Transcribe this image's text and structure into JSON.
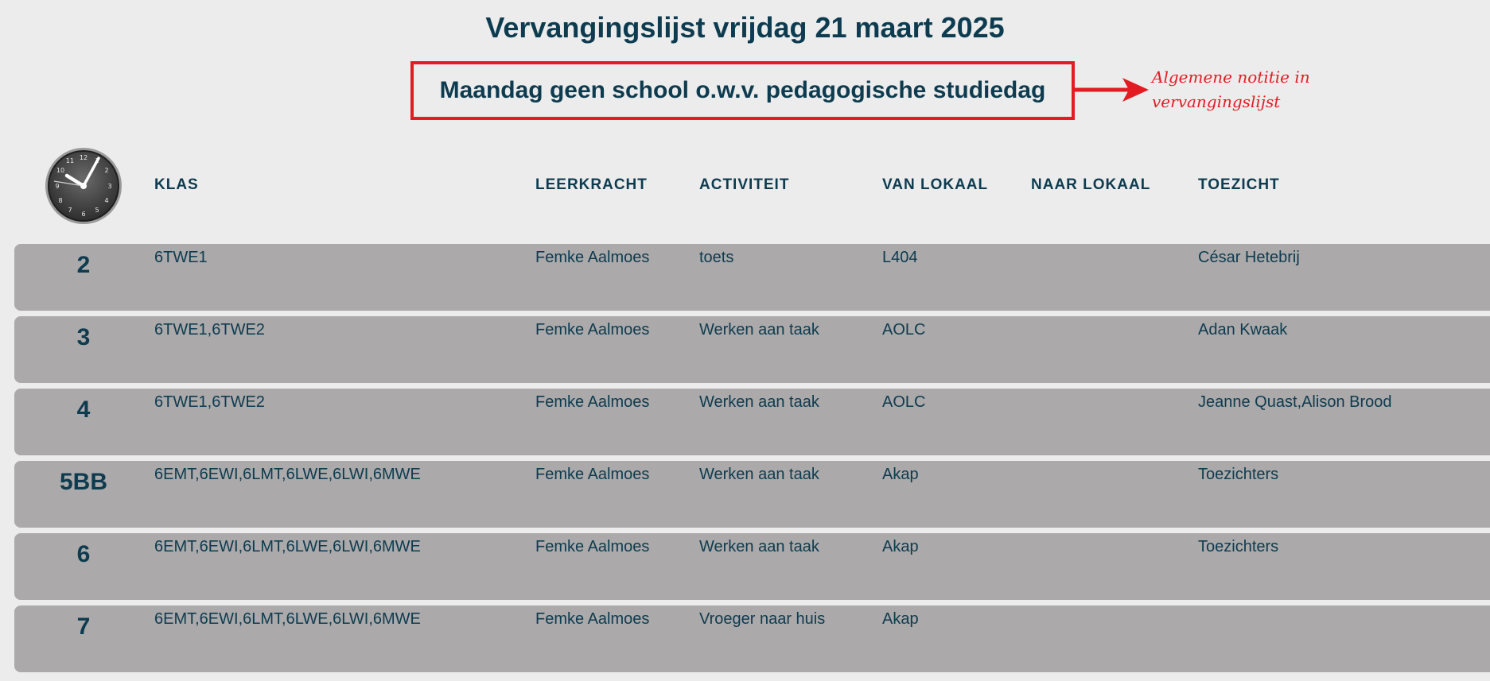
{
  "page": {
    "title": "Vervangingslijst vrijdag 21 maart 2025"
  },
  "notice": {
    "text": "Maandag geen school o.w.v. pedagogische studiedag"
  },
  "annotation": {
    "text": "Algemene notitie in vervangingslijst"
  },
  "clock_icon": "clock-icon",
  "colors": {
    "text": "#0d3b4f",
    "accent": "#e31b23",
    "row_bg": "#aba9aa",
    "page_bg": "#ececec"
  },
  "table": {
    "headers": {
      "klas": "KLAS",
      "leerkracht": "LEERKRACHT",
      "activiteit": "ACTIVITEIT",
      "van_lokaal": "VAN LOKAAL",
      "naar_lokaal": "NAAR LOKAAL",
      "toezicht": "TOEZICHT"
    },
    "rows": [
      {
        "hour": "2",
        "klas": "6TWE1",
        "leerkracht": "Femke Aalmoes",
        "activiteit": "toets",
        "van_lokaal": "L404",
        "naar_lokaal": "",
        "toezicht": "César Hetebrij"
      },
      {
        "hour": "3",
        "klas": "6TWE1,6TWE2",
        "leerkracht": "Femke Aalmoes",
        "activiteit": "Werken aan taak",
        "van_lokaal": "AOLC",
        "naar_lokaal": "",
        "toezicht": "Adan Kwaak"
      },
      {
        "hour": "4",
        "klas": "6TWE1,6TWE2",
        "leerkracht": "Femke Aalmoes",
        "activiteit": "Werken aan taak",
        "van_lokaal": "AOLC",
        "naar_lokaal": "",
        "toezicht": "Jeanne Quast,Alison Brood"
      },
      {
        "hour": "5BB",
        "klas": "6EMT,6EWI,6LMT,6LWE,6LWI,6MWE",
        "leerkracht": "Femke Aalmoes",
        "activiteit": "Werken aan taak",
        "van_lokaal": "Akap",
        "naar_lokaal": "",
        "toezicht": "Toezichters"
      },
      {
        "hour": "6",
        "klas": "6EMT,6EWI,6LMT,6LWE,6LWI,6MWE",
        "leerkracht": "Femke Aalmoes",
        "activiteit": "Werken aan taak",
        "van_lokaal": "Akap",
        "naar_lokaal": "",
        "toezicht": "Toezichters"
      },
      {
        "hour": "7",
        "klas": "6EMT,6EWI,6LMT,6LWE,6LWI,6MWE",
        "leerkracht": "Femke Aalmoes",
        "activiteit": "Vroeger naar huis",
        "van_lokaal": "Akap",
        "naar_lokaal": "",
        "toezicht": ""
      }
    ]
  }
}
